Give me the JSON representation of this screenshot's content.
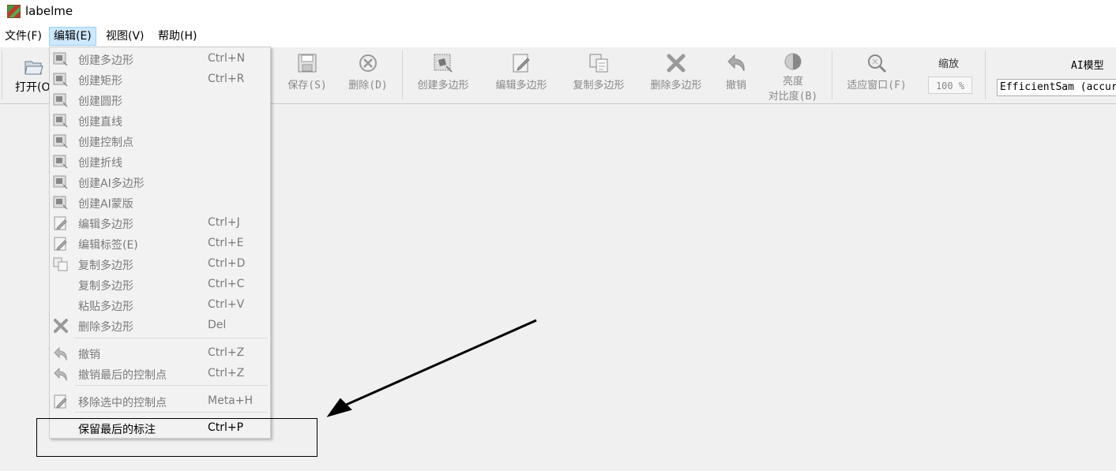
{
  "app": {
    "title": "labelme"
  },
  "menubar": [
    "文件(F)",
    "编辑(E)",
    "视图(V)",
    "帮助(H)"
  ],
  "toolbar": {
    "open_label": "打开(O)",
    "tools": [
      {
        "label": "保存(S)",
        "icon": "save-icon"
      },
      {
        "label": "删除(D)",
        "icon": "delete-icon"
      },
      {
        "label": "创建多边形",
        "icon": "create-polygon-icon"
      },
      {
        "label": "编辑多边形",
        "icon": "edit-polygon-icon"
      },
      {
        "label": "复制多边形",
        "icon": "copy-polygon-icon"
      },
      {
        "label": "删除多边形",
        "icon": "delete-polygon-icon"
      },
      {
        "label": "撤销",
        "icon": "undo-icon"
      },
      {
        "label": "亮度",
        "label2": "对比度(B)",
        "icon": "brightness-icon"
      },
      {
        "label": "适应窗口(F)",
        "icon": "fit-window-icon"
      }
    ],
    "zoom_title": "缩放",
    "zoom_value": "100 %",
    "ai_title": "AI模型",
    "ai_model": "EfficientSam (accuracy)"
  },
  "edit_menu": [
    {
      "label": "创建多边形",
      "shortcut": "Ctrl+N",
      "icon": "shape-icon"
    },
    {
      "label": "创建矩形",
      "shortcut": "Ctrl+R",
      "icon": "shape-icon"
    },
    {
      "label": "创建圆形",
      "shortcut": "",
      "icon": "shape-icon"
    },
    {
      "label": "创建直线",
      "shortcut": "",
      "icon": "shape-icon"
    },
    {
      "label": "创建控制点",
      "shortcut": "",
      "icon": "shape-icon"
    },
    {
      "label": "创建折线",
      "shortcut": "",
      "icon": "shape-icon"
    },
    {
      "label": "创建AI多边形",
      "shortcut": "",
      "icon": "shape-icon"
    },
    {
      "label": "创建AI蒙版",
      "shortcut": "",
      "icon": "shape-icon"
    },
    {
      "label": "编辑多边形",
      "shortcut": "Ctrl+J",
      "icon": "edit-icon"
    },
    {
      "label": "编辑标签(E)",
      "shortcut": "Ctrl+E",
      "icon": "edit-icon"
    },
    {
      "label": "复制多边形",
      "shortcut": "Ctrl+D",
      "icon": "copy-icon"
    },
    {
      "label": "复制多边形",
      "shortcut": "Ctrl+C",
      "icon": ""
    },
    {
      "label": "粘贴多边形",
      "shortcut": "Ctrl+V",
      "icon": ""
    },
    {
      "label": "删除多边形",
      "shortcut": "Del",
      "icon": "delete-icon"
    },
    {
      "label": "撤销",
      "shortcut": "Ctrl+Z",
      "icon": "undo-icon"
    },
    {
      "label": "撤销最后的控制点",
      "shortcut": "Ctrl+Z",
      "icon": "undo-icon"
    },
    {
      "label": "移除选中的控制点",
      "shortcut": "Meta+H",
      "icon": "edit-icon"
    },
    {
      "label": "保留最后的标注",
      "shortcut": "Ctrl+P",
      "icon": ""
    }
  ]
}
